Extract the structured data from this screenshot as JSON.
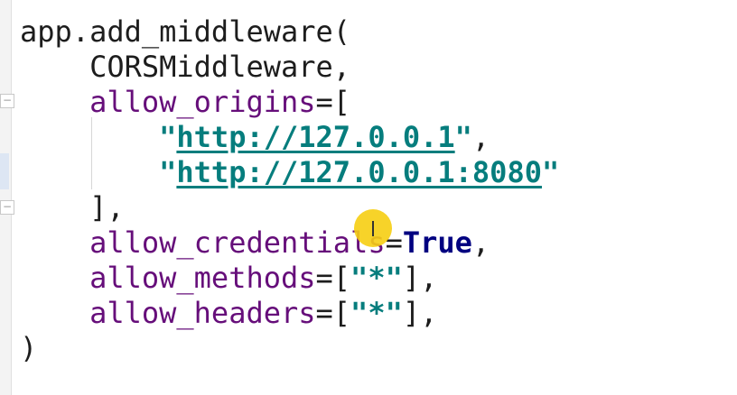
{
  "editor": {
    "lines": [
      {
        "tokens": [
          {
            "cls": "punct",
            "text": "app.add_middleware("
          }
        ]
      },
      {
        "tokens": [
          {
            "cls": "punct",
            "text": "    CORSMiddleware,"
          }
        ]
      },
      {
        "tokens": [
          {
            "cls": "punct",
            "text": "    "
          },
          {
            "cls": "kw-arg",
            "text": "allow_origins"
          },
          {
            "cls": "punct",
            "text": "=["
          }
        ]
      },
      {
        "tokens": [
          {
            "cls": "punct",
            "text": "        "
          },
          {
            "cls": "str-quote",
            "text": "\""
          },
          {
            "cls": "str-url",
            "text": "http://127.0.0.1"
          },
          {
            "cls": "str-quote",
            "text": "\""
          },
          {
            "cls": "punct",
            "text": ","
          }
        ]
      },
      {
        "tokens": [
          {
            "cls": "punct",
            "text": "        "
          },
          {
            "cls": "str-quote",
            "text": "\""
          },
          {
            "cls": "str-url",
            "text": "http://127.0.0.1:8080"
          },
          {
            "cls": "str-quote",
            "text": "\""
          }
        ]
      },
      {
        "tokens": [
          {
            "cls": "punct",
            "text": "    ],"
          }
        ]
      },
      {
        "tokens": [
          {
            "cls": "punct",
            "text": "    "
          },
          {
            "cls": "kw-arg",
            "text": "allow_credentials"
          },
          {
            "cls": "punct",
            "text": "="
          },
          {
            "cls": "const",
            "text": "True"
          },
          {
            "cls": "punct",
            "text": ","
          }
        ]
      },
      {
        "tokens": [
          {
            "cls": "punct",
            "text": "    "
          },
          {
            "cls": "kw-arg",
            "text": "allow_methods"
          },
          {
            "cls": "punct",
            "text": "=["
          },
          {
            "cls": "str-quote",
            "text": "\"*\""
          },
          {
            "cls": "punct",
            "text": "],"
          }
        ]
      },
      {
        "tokens": [
          {
            "cls": "punct",
            "text": "    "
          },
          {
            "cls": "kw-arg",
            "text": "allow_headers"
          },
          {
            "cls": "punct",
            "text": "=["
          },
          {
            "cls": "str-quote",
            "text": "\"*\""
          },
          {
            "cls": "punct",
            "text": "],"
          }
        ]
      },
      {
        "tokens": [
          {
            "cls": "punct",
            "text": ")"
          }
        ]
      }
    ],
    "fold_icons": [
      "fold-collapse-icon",
      "fold-end-icon"
    ],
    "colors": {
      "keyword_arg": "#660e7a",
      "string": "#067d7d",
      "constant": "#000080",
      "default_text": "#1d1d1d",
      "cursor_highlight": "#f6ce12"
    }
  }
}
